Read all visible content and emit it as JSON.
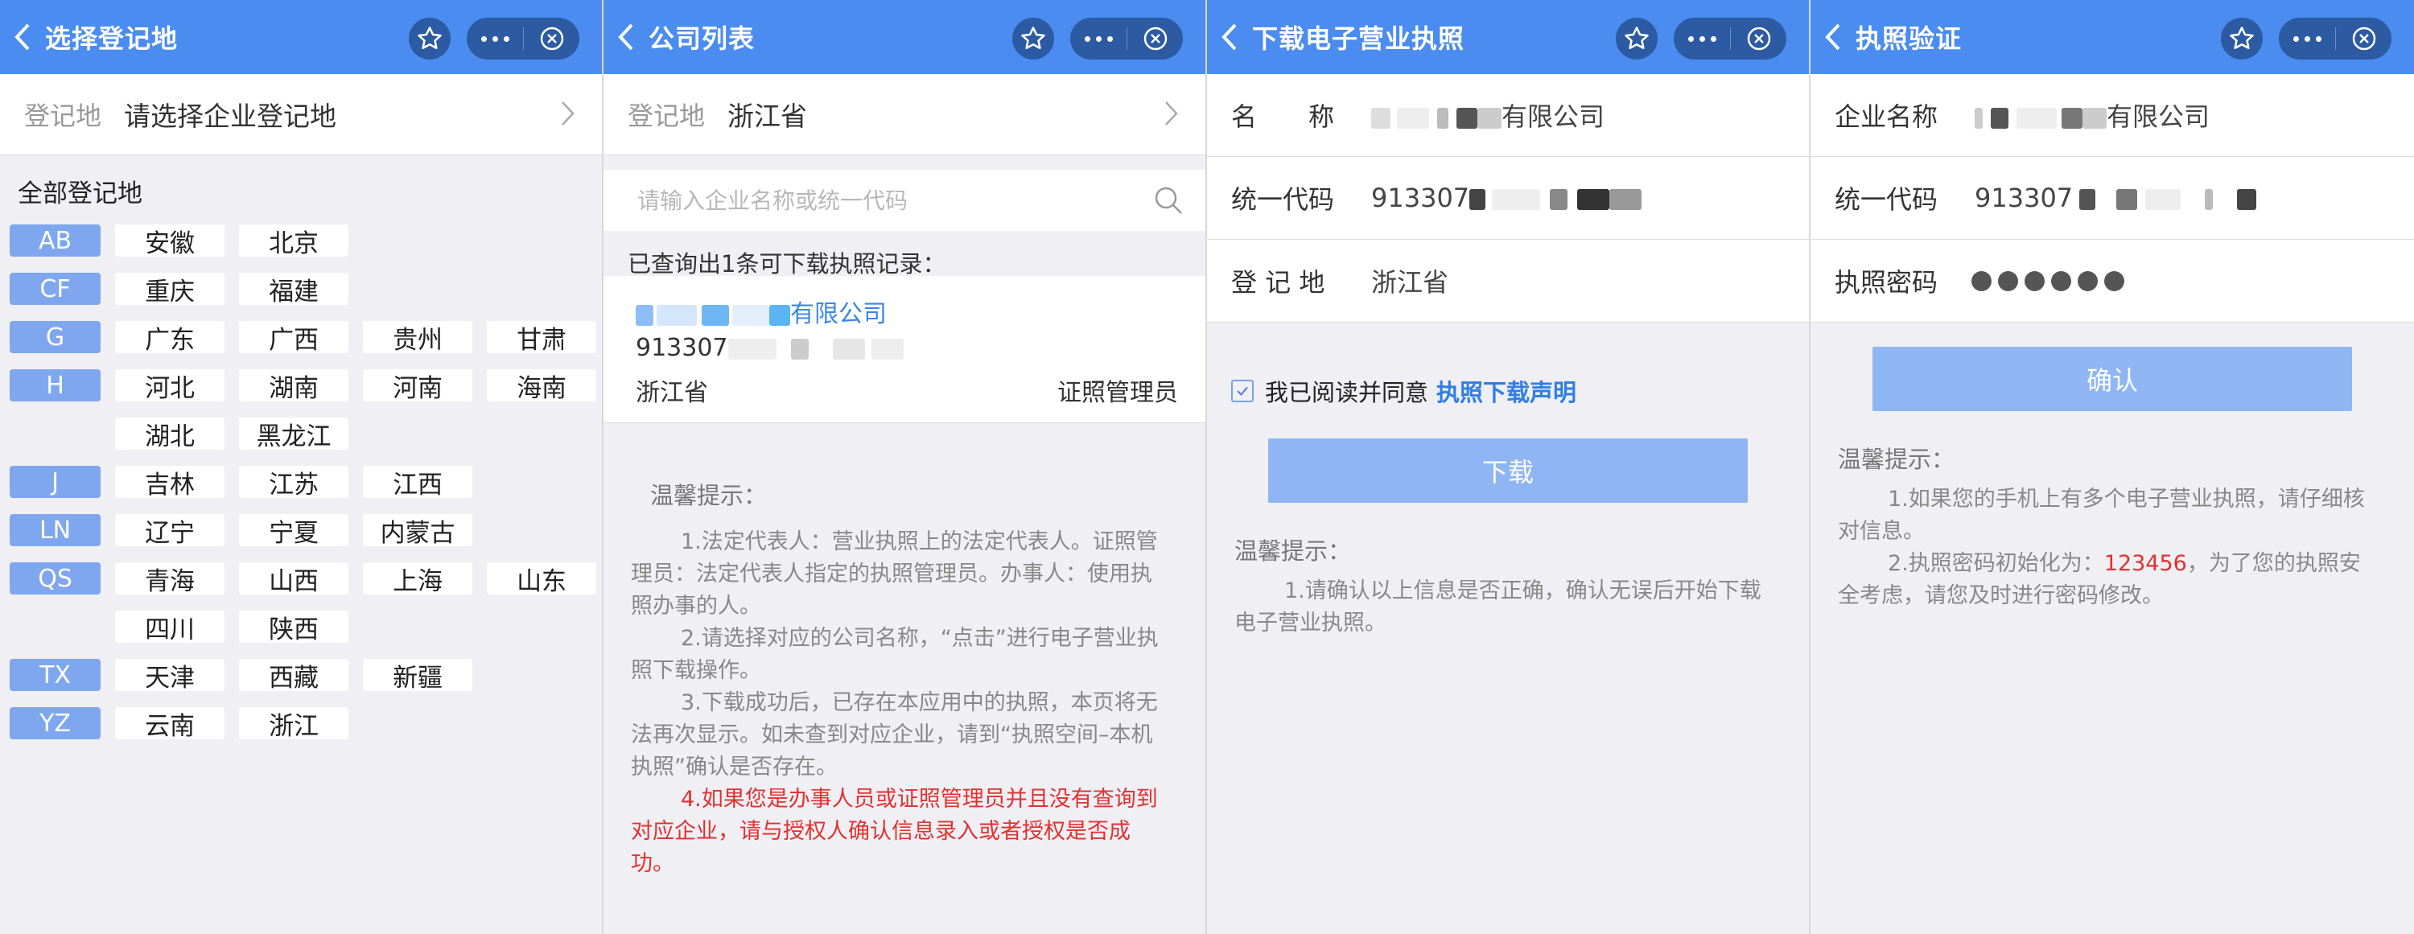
{
  "colors": {
    "header": "#4a8cf0",
    "letter_tag": "#7ea7ef",
    "button": "#8fb6f3",
    "link": "#2f7ee6",
    "warning": "#e0322f"
  },
  "screen1": {
    "title": "选择登记地",
    "reg_label": "登记地",
    "reg_value": "请选择企业登记地",
    "all_title": "全部登记地",
    "groups": [
      {
        "letter": "AB",
        "provinces": [
          "安徽",
          "北京"
        ]
      },
      {
        "letter": "CF",
        "provinces": [
          "重庆",
          "福建"
        ]
      },
      {
        "letter": "G",
        "provinces": [
          "广东",
          "广西",
          "贵州",
          "甘肃"
        ]
      },
      {
        "letter": "H",
        "provinces": [
          "河北",
          "湖南",
          "河南",
          "海南",
          "湖北",
          "黑龙江"
        ]
      },
      {
        "letter": "J",
        "provinces": [
          "吉林",
          "江苏",
          "江西"
        ]
      },
      {
        "letter": "LN",
        "provinces": [
          "辽宁",
          "宁夏",
          "内蒙古"
        ]
      },
      {
        "letter": "QS",
        "provinces": [
          "青海",
          "山西",
          "上海",
          "山东",
          "四川",
          "陕西"
        ]
      },
      {
        "letter": "TX",
        "provinces": [
          "天津",
          "西藏",
          "新疆"
        ]
      },
      {
        "letter": "YZ",
        "provinces": [
          "云南",
          "浙江"
        ]
      }
    ]
  },
  "screen2": {
    "title": "公司列表",
    "reg_label": "登记地",
    "reg_value": "浙江省",
    "search_placeholder": "请输入企业名称或统一代码",
    "result_hint": "已查询出1条可下载执照记录：",
    "result": {
      "name_suffix": "有限公司",
      "code_prefix": "913307",
      "province": "浙江省",
      "role": "证照管理员"
    },
    "tips_title": "温馨提示：",
    "tips": [
      "1.法定代表人：营业执照上的法定代表人。证照管理员：法定代表人指定的执照管理员。办事人：使用执照办事的人。",
      "2.请选择对应的公司名称，“点击”进行电子营业执照下载操作。",
      "3.下载成功后，已存在本应用中的执照，本页将无法再次显示。如未查到对应企业，请到“执照空间–本机执照”确认是否存在。"
    ],
    "tip_warning": "4.如果您是办事人员或证照管理员并且没有查询到对应企业，请与授权人确认信息录入或者授权是否成功。"
  },
  "screen3": {
    "title": "下载电子营业执照",
    "name_label": "名　　称",
    "name_suffix": "有限公司",
    "code_label": "统一代码",
    "code_prefix": "913307",
    "reg_label": "登 记 地",
    "reg_value": "浙江省",
    "agree_text": "我已阅读并同意",
    "agree_link": "执照下载声明",
    "button": "下载",
    "tips_title": "温馨提示：",
    "tip1": "1.请确认以上信息是否正确，确认无误后开始下载电子营业执照。"
  },
  "screen4": {
    "title": "执照验证",
    "name_label": "企业名称",
    "name_suffix": "有限公司",
    "code_label": "统一代码",
    "code_prefix": "913307",
    "pwd_label": "执照密码",
    "button": "确认",
    "tips_title": "温馨提示：",
    "tip1": "1.如果您的手机上有多个电子营业执照，请仔细核对信息。",
    "tip2_a": "2.执照密码初始化为：",
    "tip2_code": "123456",
    "tip2_b": "，为了您的执照安全考虑，请您及时进行密码修改。"
  }
}
